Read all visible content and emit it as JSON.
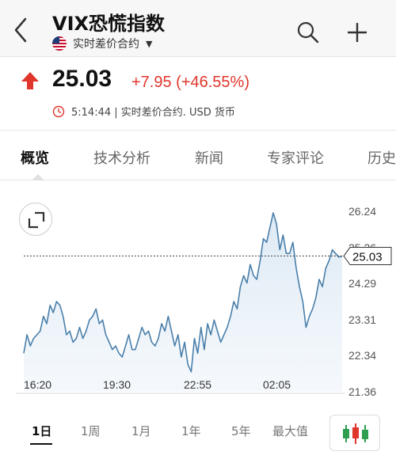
{
  "header": {
    "title": "VIX恐慌指数",
    "subtitle": "实时差价合约"
  },
  "quote": {
    "price": "25.03",
    "change": "+7.95 (+46.55%)",
    "meta": "5:14:44 | 实时差价合约.  USD 货币",
    "accent_color": "#e0362c"
  },
  "tabs": [
    "概览",
    "技术分析",
    "新闻",
    "专家评论",
    "历史"
  ],
  "ranges": [
    "1日",
    "1周",
    "1月",
    "1年",
    "5年",
    "最大值"
  ],
  "icons": {
    "back": "chevron-left-icon",
    "flag": "us-flag-icon",
    "dropdown": "caret-down-icon",
    "search": "search-icon",
    "add": "plus-icon",
    "up": "up-arrow-icon",
    "clock": "clock-icon",
    "expand": "expand-icon",
    "candles": "candlestick-icon"
  },
  "chart_data": {
    "type": "area",
    "x_ticks": [
      "16:20",
      "19:30",
      "22:55",
      "02:05"
    ],
    "y_ticks": [
      "26.24",
      "25.26",
      "24.29",
      "23.31",
      "22.34",
      "21.36"
    ],
    "ylim": [
      21.36,
      26.24
    ],
    "last_value": "25.03",
    "series": [
      {
        "values": [
          22.4,
          22.9,
          22.6,
          22.8,
          22.9,
          23.0,
          23.4,
          23.2,
          23.7,
          23.5,
          23.8,
          23.7,
          23.4,
          22.9,
          23.0,
          22.7,
          22.8,
          23.1,
          22.8,
          23.0,
          23.3,
          23.4,
          23.6,
          23.2,
          23.3,
          22.9,
          22.7,
          22.5,
          22.6,
          22.4,
          22.3,
          22.6,
          22.9,
          22.5,
          22.5,
          22.8,
          23.1,
          22.9,
          23.0,
          22.7,
          22.6,
          22.8,
          23.2,
          23.0,
          23.4,
          23.0,
          22.6,
          22.9,
          22.3,
          22.7,
          22.1,
          21.9,
          22.8,
          22.4,
          23.1,
          22.5,
          23.2,
          22.9,
          23.3,
          23.0,
          22.7,
          22.9,
          23.1,
          23.4,
          23.8,
          23.6,
          24.2,
          24.5,
          24.3,
          24.8,
          24.5,
          24.4,
          24.9,
          25.5,
          25.4,
          25.8,
          26.2,
          25.9,
          25.2,
          25.6,
          25.1,
          25.1,
          25.4,
          24.7,
          24.2,
          23.8,
          23.1,
          23.4,
          23.6,
          23.9,
          24.4,
          24.2,
          24.7,
          24.9,
          25.2,
          25.1,
          25.0,
          25.03
        ]
      }
    ]
  }
}
